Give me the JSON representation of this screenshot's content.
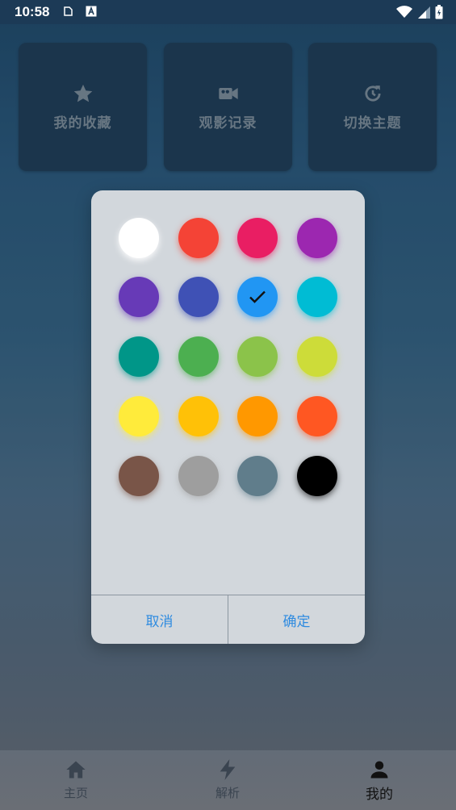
{
  "status_bar": {
    "time": "10:58"
  },
  "cards": [
    {
      "label": "我的收藏",
      "icon": "star-icon"
    },
    {
      "label": "观影记录",
      "icon": "video-camera-icon"
    },
    {
      "label": "切换主题",
      "icon": "history-icon"
    }
  ],
  "color_picker": {
    "selected": "#2196f3",
    "swatches": [
      "#ffffff",
      "#f44336",
      "#e91e63",
      "#9c27b0",
      "#673ab7",
      "#3f51b5",
      "#2196f3",
      "#00bcd4",
      "#009688",
      "#4caf50",
      "#8bc34a",
      "#cddc39",
      "#ffeb3b",
      "#ffc107",
      "#ff9800",
      "#ff5722",
      "#795548",
      "#9e9e9e",
      "#607d8b",
      "#000000"
    ],
    "cancel_label": "取消",
    "confirm_label": "确定"
  },
  "bottom_nav": [
    {
      "label": "主页",
      "icon": "home-icon",
      "active": false
    },
    {
      "label": "解析",
      "icon": "lightning-icon",
      "active": false
    },
    {
      "label": "我的",
      "icon": "person-icon",
      "active": true
    }
  ]
}
